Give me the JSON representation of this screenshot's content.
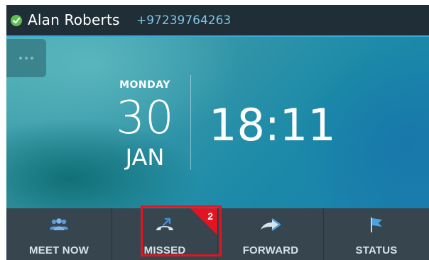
{
  "header": {
    "user_name": "Alan Roberts",
    "user_number": "+97239764263",
    "presence_status": "available",
    "presence_color": "#5cc04e"
  },
  "clock": {
    "day": "MONDAY",
    "date": "30",
    "month": "JAN",
    "time": "18:11"
  },
  "softkeys": [
    {
      "label": "MEET NOW",
      "icon": "people-icon"
    },
    {
      "label": "MISSED",
      "icon": "missed-call-icon",
      "badge": "2"
    },
    {
      "label": "FORWARD",
      "icon": "forward-icon"
    },
    {
      "label": "STATUS",
      "icon": "flag-icon"
    }
  ],
  "colors": {
    "accent": "#39a9d8",
    "badge": "#e3141f",
    "topbar": "#1f2e37",
    "bottombar": "#37454e"
  }
}
